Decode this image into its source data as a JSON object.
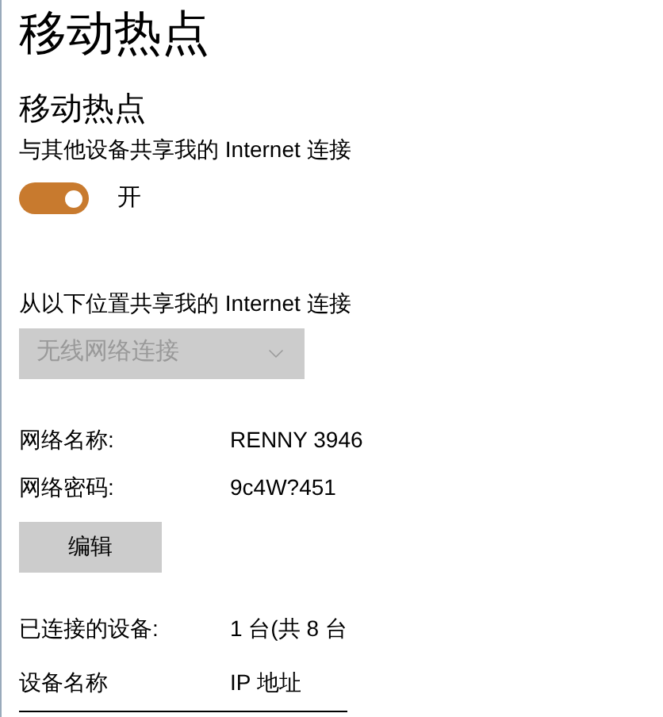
{
  "page_title": "移动热点",
  "hotspot": {
    "heading": "移动热点",
    "description": "与其他设备共享我的 Internet 连接",
    "toggle": {
      "on": true,
      "label": "开"
    }
  },
  "share_from": {
    "label": "从以下位置共享我的 Internet 连接",
    "dropdown": {
      "value": "无线网络连接",
      "disabled": true
    }
  },
  "details": [
    {
      "label": "网络名称:",
      "value": "RENNY 3946"
    },
    {
      "label": "网络密码:",
      "value": "9c4W?451"
    }
  ],
  "edit_button": "编辑",
  "connected": {
    "label": "已连接的设备:",
    "value": "1 台(共 8 台"
  },
  "table": {
    "columns": [
      "设备名称",
      "IP 地址"
    ]
  }
}
